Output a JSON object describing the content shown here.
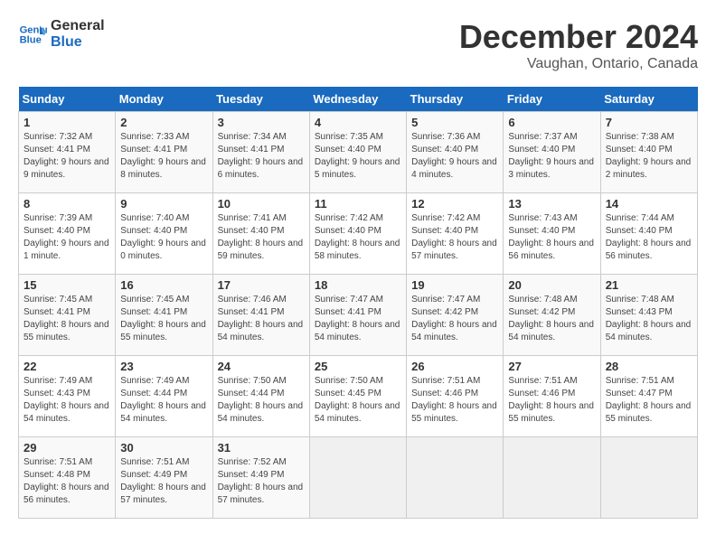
{
  "header": {
    "logo_line1": "General",
    "logo_line2": "Blue",
    "month_title": "December 2024",
    "location": "Vaughan, Ontario, Canada"
  },
  "days_of_week": [
    "Sunday",
    "Monday",
    "Tuesday",
    "Wednesday",
    "Thursday",
    "Friday",
    "Saturday"
  ],
  "weeks": [
    [
      {
        "day": 1,
        "sunrise": "7:32 AM",
        "sunset": "4:41 PM",
        "daylight": "9 hours and 9 minutes."
      },
      {
        "day": 2,
        "sunrise": "7:33 AM",
        "sunset": "4:41 PM",
        "daylight": "9 hours and 8 minutes."
      },
      {
        "day": 3,
        "sunrise": "7:34 AM",
        "sunset": "4:41 PM",
        "daylight": "9 hours and 6 minutes."
      },
      {
        "day": 4,
        "sunrise": "7:35 AM",
        "sunset": "4:40 PM",
        "daylight": "9 hours and 5 minutes."
      },
      {
        "day": 5,
        "sunrise": "7:36 AM",
        "sunset": "4:40 PM",
        "daylight": "9 hours and 4 minutes."
      },
      {
        "day": 6,
        "sunrise": "7:37 AM",
        "sunset": "4:40 PM",
        "daylight": "9 hours and 3 minutes."
      },
      {
        "day": 7,
        "sunrise": "7:38 AM",
        "sunset": "4:40 PM",
        "daylight": "9 hours and 2 minutes."
      }
    ],
    [
      {
        "day": 8,
        "sunrise": "7:39 AM",
        "sunset": "4:40 PM",
        "daylight": "9 hours and 1 minute."
      },
      {
        "day": 9,
        "sunrise": "7:40 AM",
        "sunset": "4:40 PM",
        "daylight": "9 hours and 0 minutes."
      },
      {
        "day": 10,
        "sunrise": "7:41 AM",
        "sunset": "4:40 PM",
        "daylight": "8 hours and 59 minutes."
      },
      {
        "day": 11,
        "sunrise": "7:42 AM",
        "sunset": "4:40 PM",
        "daylight": "8 hours and 58 minutes."
      },
      {
        "day": 12,
        "sunrise": "7:42 AM",
        "sunset": "4:40 PM",
        "daylight": "8 hours and 57 minutes."
      },
      {
        "day": 13,
        "sunrise": "7:43 AM",
        "sunset": "4:40 PM",
        "daylight": "8 hours and 56 minutes."
      },
      {
        "day": 14,
        "sunrise": "7:44 AM",
        "sunset": "4:40 PM",
        "daylight": "8 hours and 56 minutes."
      }
    ],
    [
      {
        "day": 15,
        "sunrise": "7:45 AM",
        "sunset": "4:41 PM",
        "daylight": "8 hours and 55 minutes."
      },
      {
        "day": 16,
        "sunrise": "7:45 AM",
        "sunset": "4:41 PM",
        "daylight": "8 hours and 55 minutes."
      },
      {
        "day": 17,
        "sunrise": "7:46 AM",
        "sunset": "4:41 PM",
        "daylight": "8 hours and 54 minutes."
      },
      {
        "day": 18,
        "sunrise": "7:47 AM",
        "sunset": "4:41 PM",
        "daylight": "8 hours and 54 minutes."
      },
      {
        "day": 19,
        "sunrise": "7:47 AM",
        "sunset": "4:42 PM",
        "daylight": "8 hours and 54 minutes."
      },
      {
        "day": 20,
        "sunrise": "7:48 AM",
        "sunset": "4:42 PM",
        "daylight": "8 hours and 54 minutes."
      },
      {
        "day": 21,
        "sunrise": "7:48 AM",
        "sunset": "4:43 PM",
        "daylight": "8 hours and 54 minutes."
      }
    ],
    [
      {
        "day": 22,
        "sunrise": "7:49 AM",
        "sunset": "4:43 PM",
        "daylight": "8 hours and 54 minutes."
      },
      {
        "day": 23,
        "sunrise": "7:49 AM",
        "sunset": "4:44 PM",
        "daylight": "8 hours and 54 minutes."
      },
      {
        "day": 24,
        "sunrise": "7:50 AM",
        "sunset": "4:44 PM",
        "daylight": "8 hours and 54 minutes."
      },
      {
        "day": 25,
        "sunrise": "7:50 AM",
        "sunset": "4:45 PM",
        "daylight": "8 hours and 54 minutes."
      },
      {
        "day": 26,
        "sunrise": "7:51 AM",
        "sunset": "4:46 PM",
        "daylight": "8 hours and 55 minutes."
      },
      {
        "day": 27,
        "sunrise": "7:51 AM",
        "sunset": "4:46 PM",
        "daylight": "8 hours and 55 minutes."
      },
      {
        "day": 28,
        "sunrise": "7:51 AM",
        "sunset": "4:47 PM",
        "daylight": "8 hours and 55 minutes."
      }
    ],
    [
      {
        "day": 29,
        "sunrise": "7:51 AM",
        "sunset": "4:48 PM",
        "daylight": "8 hours and 56 minutes."
      },
      {
        "day": 30,
        "sunrise": "7:51 AM",
        "sunset": "4:49 PM",
        "daylight": "8 hours and 57 minutes."
      },
      {
        "day": 31,
        "sunrise": "7:52 AM",
        "sunset": "4:49 PM",
        "daylight": "8 hours and 57 minutes."
      },
      null,
      null,
      null,
      null
    ]
  ]
}
